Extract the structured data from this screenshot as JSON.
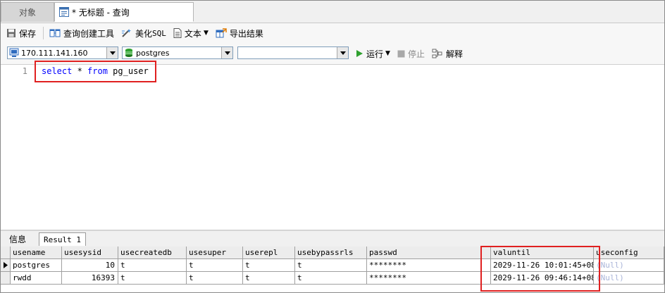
{
  "tabs": {
    "objects": "对象",
    "query": "* 无标题 - 查询"
  },
  "toolbar": {
    "save": "保存",
    "query_builder": "查询创建工具",
    "beautify_sql_prefix": "美化 ",
    "beautify_sql_code": "SQL",
    "text": "文本",
    "export": "导出结果"
  },
  "connection": {
    "host": "170.111.141.160",
    "database": "postgres",
    "schema": "",
    "run": "运行",
    "stop": "停止",
    "explain": "解释"
  },
  "editor": {
    "line_number": "1",
    "sql": {
      "kw1": "select",
      "star": " * ",
      "kw2": "from",
      "table": " pg_user"
    }
  },
  "result_tabs": {
    "info": "信息",
    "result": "Result 1"
  },
  "grid": {
    "columns": [
      "usename",
      "usesysid",
      "usecreatedb",
      "usesuper",
      "userepl",
      "usebypassrls",
      "passwd",
      "valuntil",
      "useconfig"
    ],
    "rows": [
      [
        "postgres",
        "10",
        "t",
        "t",
        "t",
        "t",
        "********",
        "2029-11-26 10:01:45+08",
        "(Null)"
      ],
      [
        "rwdd",
        "16393",
        "t",
        "t",
        "t",
        "t",
        "********",
        "2029-11-26 09:46:14+08",
        "(Null)"
      ]
    ]
  },
  "colors": {
    "highlight": "#e02020",
    "keyword": "#0000ff",
    "run_green": "#2ea02e"
  }
}
